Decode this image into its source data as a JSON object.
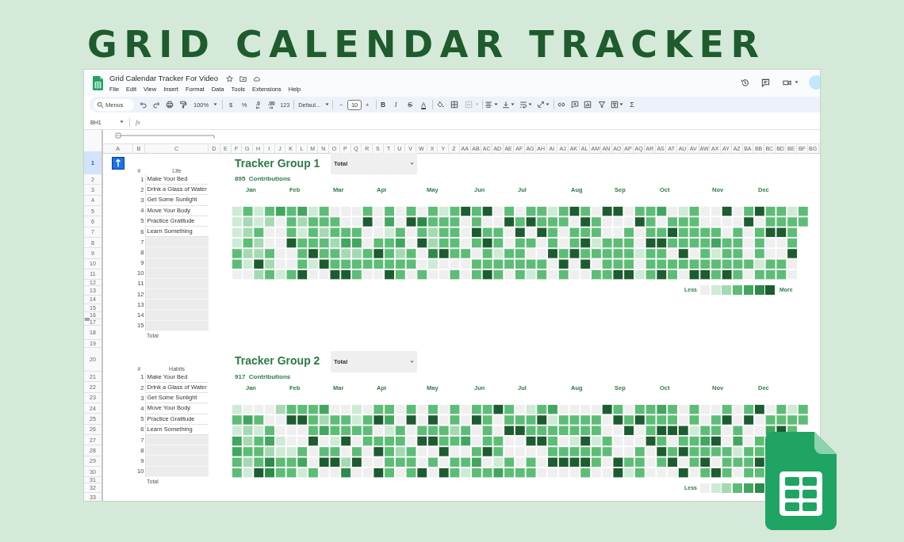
{
  "banner": {
    "title": "GRID CALENDAR TRACKER"
  },
  "window": {
    "title": "Grid Calendar Tracker For Video",
    "menu": [
      "File",
      "Edit",
      "View",
      "Insert",
      "Format",
      "Data",
      "Tools",
      "Extensions",
      "Help"
    ]
  },
  "toolbar": {
    "search": {
      "placeholder": "Menus"
    },
    "zoom": "100%",
    "currency": "$",
    "percent": "%",
    "decrease_decimals": ".0",
    "increase_decimals": ".00",
    "number_formats": "123",
    "font": "Defaul...",
    "size_down": "−",
    "font_size": "10",
    "size_up": "+",
    "bold": "B",
    "italic": "I",
    "strikethrough": "S",
    "text_color": "A",
    "merge_cells": {
      "disabled": true
    },
    "functions": "Σ"
  },
  "formula_bar": {
    "cell": "BH1",
    "fx": "fx"
  },
  "sheet": {
    "columns": [
      "A",
      "B",
      "C",
      "D",
      "E",
      "F",
      "G",
      "H",
      "I",
      "J",
      "K",
      "L",
      "M",
      "N",
      "O",
      "P",
      "Q",
      "R",
      "S",
      "T",
      "U",
      "V",
      "W",
      "X",
      "Y",
      "Z",
      "AA",
      "AB",
      "AC",
      "AD",
      "AE",
      "AF",
      "AG",
      "AH",
      "AI",
      "AJ",
      "AK",
      "AL",
      "AM",
      "AN",
      "AO",
      "AP",
      "AQ",
      "AR",
      "AS",
      "AT",
      "AU",
      "AV",
      "AW",
      "AX",
      "AY",
      "AZ",
      "BA",
      "BB",
      "BC",
      "BD",
      "BE",
      "BF",
      "BG"
    ],
    "rows": [
      {
        "label": "1",
        "selected": true,
        "hidden_below": false
      },
      {
        "label": "2",
        "selected": false,
        "hidden_below": false
      },
      {
        "label": "3",
        "selected": false,
        "hidden_below": false
      },
      {
        "label": "4",
        "selected": false,
        "hidden_below": false
      },
      {
        "label": "5",
        "selected": false,
        "hidden_below": false
      },
      {
        "label": "6",
        "selected": false,
        "hidden_below": false
      },
      {
        "label": "7",
        "selected": false,
        "hidden_below": false
      },
      {
        "label": "8",
        "selected": false,
        "hidden_below": false
      },
      {
        "label": "9",
        "selected": false,
        "hidden_below": false
      },
      {
        "label": "10",
        "selected": false,
        "hidden_below": false
      },
      {
        "label": "11",
        "selected": false,
        "hidden_below": false
      },
      {
        "label": "12",
        "selected": false,
        "hidden_below": false
      },
      {
        "label": "13",
        "selected": false,
        "hidden_below": false
      },
      {
        "label": "14",
        "selected": false,
        "hidden_below": false
      },
      {
        "label": "15",
        "selected": false,
        "hidden_below": false
      },
      {
        "label": "16",
        "selected": false,
        "hidden_below": true
      },
      {
        "label": "17",
        "selected": false,
        "hidden_below": false
      },
      {
        "label": "18",
        "selected": false,
        "hidden_below": false
      },
      {
        "label": "19",
        "selected": false,
        "hidden_below": false
      },
      {
        "label": "20",
        "selected": false,
        "hidden_below": false
      },
      {
        "label": "21",
        "selected": false,
        "hidden_below": false
      },
      {
        "label": "22",
        "selected": false,
        "hidden_below": false
      },
      {
        "label": "23",
        "selected": false,
        "hidden_below": false
      },
      {
        "label": "24",
        "selected": false,
        "hidden_below": false
      },
      {
        "label": "25",
        "selected": false,
        "hidden_below": false
      },
      {
        "label": "26",
        "selected": false,
        "hidden_below": false
      },
      {
        "label": "27",
        "selected": false,
        "hidden_below": false
      },
      {
        "label": "28",
        "selected": false,
        "hidden_below": false
      },
      {
        "label": "29",
        "selected": false,
        "hidden_below": false
      },
      {
        "label": "30",
        "selected": false,
        "hidden_below": false
      },
      {
        "label": "31",
        "selected": false,
        "hidden_below": false
      },
      {
        "label": "32",
        "selected": false,
        "hidden_below": false
      },
      {
        "label": "33",
        "selected": false,
        "hidden_below": false
      }
    ]
  },
  "groups": [
    {
      "top_button": true,
      "table": {
        "number_heading": "#",
        "heading": "Life",
        "items": [
          {
            "number": "1",
            "name": "Make Your Bed"
          },
          {
            "number": "2",
            "name": "Drink a Glass of Water"
          },
          {
            "number": "3",
            "name": "Get Some Sunlight"
          },
          {
            "number": "4",
            "name": "Move Your Body"
          },
          {
            "number": "5",
            "name": "Practice Gratitude"
          },
          {
            "number": "6",
            "name": "Learn Something"
          },
          {
            "number": "7"
          },
          {
            "number": "8"
          },
          {
            "number": "9"
          },
          {
            "number": "10"
          },
          {
            "number": "11"
          },
          {
            "number": "12"
          },
          {
            "number": "13"
          },
          {
            "number": "14"
          },
          {
            "number": "15"
          }
        ],
        "total": "Total"
      },
      "title": "Tracker Group 1",
      "dropdown": "Total",
      "contributions": "895  Contributions",
      "months": [
        "Jan",
        "Feb",
        "Mar",
        "Api",
        "May",
        "Jun",
        "Jul",
        "Aug",
        "Sep",
        "Oct",
        "Nov",
        "Dec"
      ],
      "legend": {
        "less": "Less",
        "swatches": [
          {
            "color": "#efefef"
          },
          {
            "color": "#cdebd5"
          },
          {
            "color": "#a5d9b2"
          },
          {
            "color": "#5dbd76"
          },
          {
            "color": "#42a660"
          },
          {
            "color": "#2e8a4b"
          },
          {
            "color": "#1d5c30"
          }
        ],
        "more": "More"
      }
    },
    {
      "table": {
        "number_heading": "#",
        "heading": "Habits",
        "items": [
          {
            "number": "1",
            "name": "Make Your Bed"
          },
          {
            "number": "2",
            "name": "Drink a Glass of Water"
          },
          {
            "number": "3",
            "name": "Get Some Sunlight"
          },
          {
            "number": "4",
            "name": "Move Your Body"
          },
          {
            "number": "5",
            "name": "Practice Gratitude"
          },
          {
            "number": "6",
            "name": "Learn Something"
          },
          {
            "number": "7"
          },
          {
            "number": "8"
          },
          {
            "number": "9"
          },
          {
            "number": "10"
          }
        ],
        "total": "Total"
      },
      "title": "Tracker Group 2",
      "dropdown": "Total",
      "contributions": "917  Contributions",
      "months": [
        "Jan",
        "Feb",
        "Mar",
        "Api",
        "May",
        "Jun",
        "Jul",
        "Aug",
        "Sep",
        "Oct",
        "Nov",
        "Dec"
      ],
      "legend": {
        "less": "Less",
        "swatches": [
          {
            "color": "#efefef"
          },
          {
            "color": "#cdebd5"
          },
          {
            "color": "#a5d9b2"
          },
          {
            "color": "#5dbd76"
          },
          {
            "color": "#42a660"
          },
          {
            "color": "#2e8a4b"
          }
        ]
      }
    }
  ]
}
